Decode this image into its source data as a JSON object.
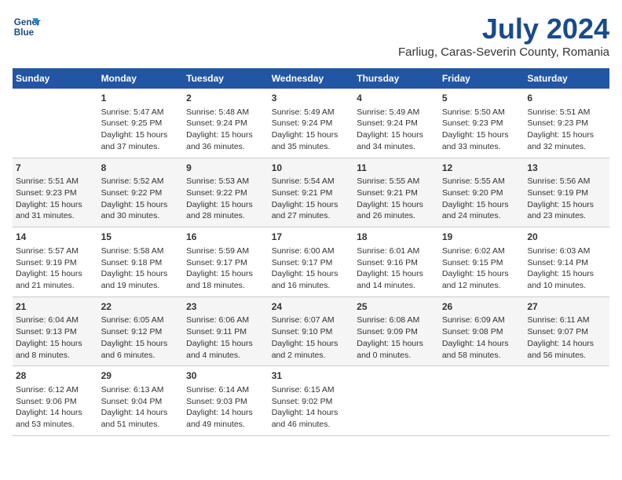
{
  "logo": {
    "line1": "General",
    "line2": "Blue"
  },
  "title": "July 2024",
  "subtitle": "Farliug, Caras-Severin County, Romania",
  "days_of_week": [
    "Sunday",
    "Monday",
    "Tuesday",
    "Wednesday",
    "Thursday",
    "Friday",
    "Saturday"
  ],
  "weeks": [
    [
      {
        "day": "",
        "info": ""
      },
      {
        "day": "1",
        "info": "Sunrise: 5:47 AM\nSunset: 9:25 PM\nDaylight: 15 hours\nand 37 minutes."
      },
      {
        "day": "2",
        "info": "Sunrise: 5:48 AM\nSunset: 9:24 PM\nDaylight: 15 hours\nand 36 minutes."
      },
      {
        "day": "3",
        "info": "Sunrise: 5:49 AM\nSunset: 9:24 PM\nDaylight: 15 hours\nand 35 minutes."
      },
      {
        "day": "4",
        "info": "Sunrise: 5:49 AM\nSunset: 9:24 PM\nDaylight: 15 hours\nand 34 minutes."
      },
      {
        "day": "5",
        "info": "Sunrise: 5:50 AM\nSunset: 9:23 PM\nDaylight: 15 hours\nand 33 minutes."
      },
      {
        "day": "6",
        "info": "Sunrise: 5:51 AM\nSunset: 9:23 PM\nDaylight: 15 hours\nand 32 minutes."
      }
    ],
    [
      {
        "day": "7",
        "info": "Sunrise: 5:51 AM\nSunset: 9:23 PM\nDaylight: 15 hours\nand 31 minutes."
      },
      {
        "day": "8",
        "info": "Sunrise: 5:52 AM\nSunset: 9:22 PM\nDaylight: 15 hours\nand 30 minutes."
      },
      {
        "day": "9",
        "info": "Sunrise: 5:53 AM\nSunset: 9:22 PM\nDaylight: 15 hours\nand 28 minutes."
      },
      {
        "day": "10",
        "info": "Sunrise: 5:54 AM\nSunset: 9:21 PM\nDaylight: 15 hours\nand 27 minutes."
      },
      {
        "day": "11",
        "info": "Sunrise: 5:55 AM\nSunset: 9:21 PM\nDaylight: 15 hours\nand 26 minutes."
      },
      {
        "day": "12",
        "info": "Sunrise: 5:55 AM\nSunset: 9:20 PM\nDaylight: 15 hours\nand 24 minutes."
      },
      {
        "day": "13",
        "info": "Sunrise: 5:56 AM\nSunset: 9:19 PM\nDaylight: 15 hours\nand 23 minutes."
      }
    ],
    [
      {
        "day": "14",
        "info": "Sunrise: 5:57 AM\nSunset: 9:19 PM\nDaylight: 15 hours\nand 21 minutes."
      },
      {
        "day": "15",
        "info": "Sunrise: 5:58 AM\nSunset: 9:18 PM\nDaylight: 15 hours\nand 19 minutes."
      },
      {
        "day": "16",
        "info": "Sunrise: 5:59 AM\nSunset: 9:17 PM\nDaylight: 15 hours\nand 18 minutes."
      },
      {
        "day": "17",
        "info": "Sunrise: 6:00 AM\nSunset: 9:17 PM\nDaylight: 15 hours\nand 16 minutes."
      },
      {
        "day": "18",
        "info": "Sunrise: 6:01 AM\nSunset: 9:16 PM\nDaylight: 15 hours\nand 14 minutes."
      },
      {
        "day": "19",
        "info": "Sunrise: 6:02 AM\nSunset: 9:15 PM\nDaylight: 15 hours\nand 12 minutes."
      },
      {
        "day": "20",
        "info": "Sunrise: 6:03 AM\nSunset: 9:14 PM\nDaylight: 15 hours\nand 10 minutes."
      }
    ],
    [
      {
        "day": "21",
        "info": "Sunrise: 6:04 AM\nSunset: 9:13 PM\nDaylight: 15 hours\nand 8 minutes."
      },
      {
        "day": "22",
        "info": "Sunrise: 6:05 AM\nSunset: 9:12 PM\nDaylight: 15 hours\nand 6 minutes."
      },
      {
        "day": "23",
        "info": "Sunrise: 6:06 AM\nSunset: 9:11 PM\nDaylight: 15 hours\nand 4 minutes."
      },
      {
        "day": "24",
        "info": "Sunrise: 6:07 AM\nSunset: 9:10 PM\nDaylight: 15 hours\nand 2 minutes."
      },
      {
        "day": "25",
        "info": "Sunrise: 6:08 AM\nSunset: 9:09 PM\nDaylight: 15 hours\nand 0 minutes."
      },
      {
        "day": "26",
        "info": "Sunrise: 6:09 AM\nSunset: 9:08 PM\nDaylight: 14 hours\nand 58 minutes."
      },
      {
        "day": "27",
        "info": "Sunrise: 6:11 AM\nSunset: 9:07 PM\nDaylight: 14 hours\nand 56 minutes."
      }
    ],
    [
      {
        "day": "28",
        "info": "Sunrise: 6:12 AM\nSunset: 9:06 PM\nDaylight: 14 hours\nand 53 minutes."
      },
      {
        "day": "29",
        "info": "Sunrise: 6:13 AM\nSunset: 9:04 PM\nDaylight: 14 hours\nand 51 minutes."
      },
      {
        "day": "30",
        "info": "Sunrise: 6:14 AM\nSunset: 9:03 PM\nDaylight: 14 hours\nand 49 minutes."
      },
      {
        "day": "31",
        "info": "Sunrise: 6:15 AM\nSunset: 9:02 PM\nDaylight: 14 hours\nand 46 minutes."
      },
      {
        "day": "",
        "info": ""
      },
      {
        "day": "",
        "info": ""
      },
      {
        "day": "",
        "info": ""
      }
    ]
  ]
}
